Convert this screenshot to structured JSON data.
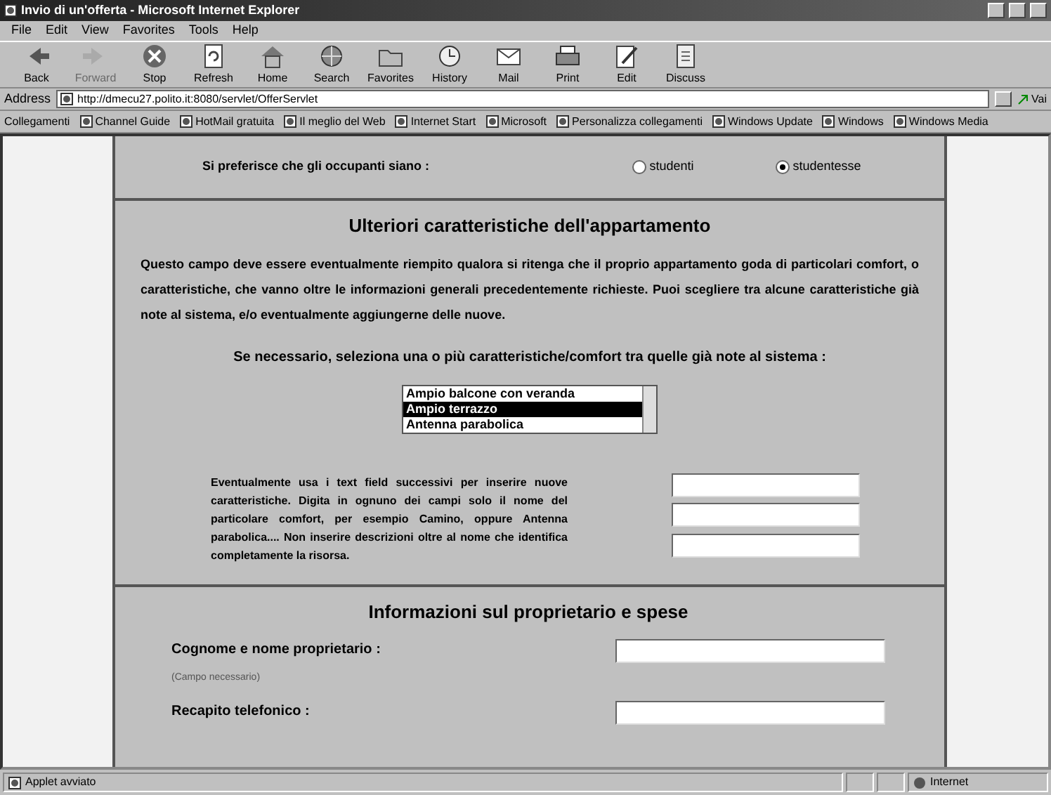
{
  "window": {
    "title": "Invio di un'offerta - Microsoft Internet Explorer"
  },
  "menu": [
    "File",
    "Edit",
    "View",
    "Favorites",
    "Tools",
    "Help"
  ],
  "toolbar": [
    {
      "label": "Back",
      "kind": "back",
      "disabled": false
    },
    {
      "label": "Forward",
      "kind": "forward",
      "disabled": true
    },
    {
      "label": "Stop",
      "kind": "stop",
      "disabled": false
    },
    {
      "label": "Refresh",
      "kind": "refresh",
      "disabled": false
    },
    {
      "label": "Home",
      "kind": "home",
      "disabled": false
    },
    {
      "label": "Search",
      "kind": "search",
      "disabled": false
    },
    {
      "label": "Favorites",
      "kind": "favorites",
      "disabled": false
    },
    {
      "label": "History",
      "kind": "history",
      "disabled": false
    },
    {
      "label": "Mail",
      "kind": "mail",
      "disabled": false
    },
    {
      "label": "Print",
      "kind": "print",
      "disabled": false
    },
    {
      "label": "Edit",
      "kind": "edit",
      "disabled": false
    },
    {
      "label": "Discuss",
      "kind": "discuss",
      "disabled": false
    }
  ],
  "address": {
    "label": "Address",
    "value": "http://dmecu27.polito.it:8080/servlet/OfferServlet",
    "go": "Vai"
  },
  "links": {
    "label": "Collegamenti",
    "items": [
      "Channel Guide",
      "HotMail gratuita",
      "Il meglio del Web",
      "Internet Start",
      "Microsoft",
      "Personalizza collegamenti",
      "Windows Update",
      "Windows",
      "Windows Media"
    ]
  },
  "occupants": {
    "label": "Si preferisce che gli occupanti siano :",
    "options": [
      {
        "label": "studenti",
        "selected": false
      },
      {
        "label": "studentesse",
        "selected": true
      }
    ]
  },
  "features": {
    "heading": "Ulteriori caratteristiche dell'appartamento",
    "intro": "Questo campo deve essere eventualmente riempito qualora si ritenga che il proprio appartamento goda di particolari comfort, o caratteristiche, che vanno  oltre le informazioni generali  precedentemente richieste. Puoi scegliere tra alcune caratteristiche già note al sistema,  e/o eventualmente  aggiungerne delle nuove.",
    "select_label": "Se necessario, seleziona una o più caratteristiche/comfort tra quelle già note al sistema :",
    "options": [
      {
        "label": "Ampio balcone con veranda",
        "selected": false
      },
      {
        "label": "Ampio terrazzo",
        "selected": true
      },
      {
        "label": "Antenna parabolica",
        "selected": false
      }
    ],
    "hint": "Eventualmente  usa i text field successivi  per  inserire nuove caratteristiche. Digita in ognuno dei campi solo il nome del particolare comfort, per esempio  Camino, oppure Antenna parabolica.... Non inserire descrizioni oltre al nome che identifica completamente la risorsa."
  },
  "owner": {
    "heading": "Informazioni sul proprietario e spese",
    "fields": [
      {
        "label": "Cognome e nome proprietario :",
        "note": "(Campo necessario)"
      },
      {
        "label": "Recapito telefonico :"
      }
    ]
  },
  "status_bar": {
    "text": "Applet avviato",
    "zone": "Internet"
  }
}
